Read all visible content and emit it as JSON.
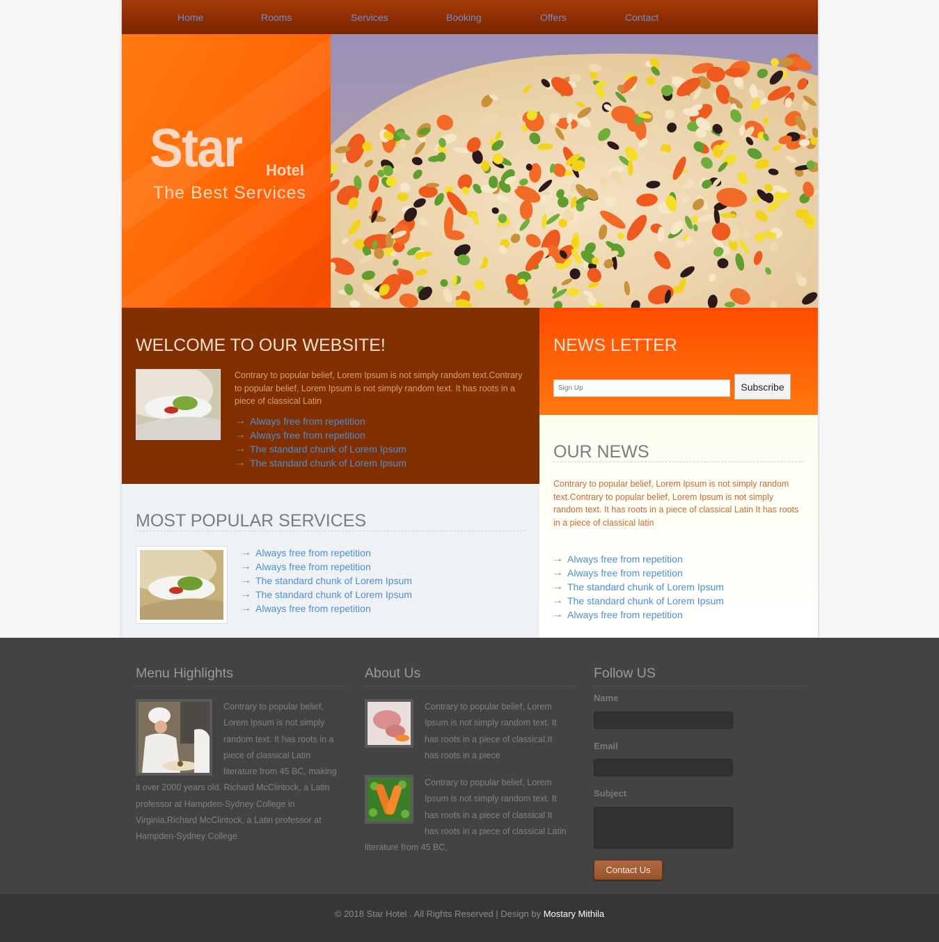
{
  "nav": {
    "items": [
      "Home",
      "Rooms",
      "Services",
      "Booking",
      "Offers",
      "Contact"
    ]
  },
  "hero": {
    "logo_main": "Star",
    "logo_sub": "Hotel",
    "tagline": "The Best Services"
  },
  "welcome": {
    "title": "WELCOME TO OUR WEBSITE!",
    "text": "Contrary to popular belief, Lorem Ipsum is not simply random text.Contrary to popular belief, Lorem Ipsum is not simply random text. It has roots in a piece of classical Latin",
    "items": [
      "Always free from repetition",
      "Always free from repetition",
      "The standard chunk of Lorem Ipsum",
      "The standard chunk of Lorem Ipsum"
    ]
  },
  "newsletter": {
    "title": "NEWS LETTER",
    "placeholder": "Sign Up",
    "button": "Subscribe"
  },
  "our_news": {
    "title": "OUR NEWS",
    "text": "Contrary to popular belief, Lorem Ipsum is not simply random text.Contrary to popular belief, Lorem Ipsum is not simply random text. It has roots in a piece of classical Latin It has roots in a piece of classical latin",
    "items": [
      "Always free from repetition",
      "Always free from repetition",
      "The standard chunk of Lorem Ipsum",
      "The standard chunk of Lorem Ipsum",
      "Always free from repetition"
    ]
  },
  "popular": {
    "title": "MOST POPULAR SERVICES",
    "items": [
      "Always free from repetition",
      "Always free from repetition",
      "The standard chunk of Lorem Ipsum",
      "The standard chunk of Lorem Ipsum",
      "Always free from repetition"
    ]
  },
  "footer": {
    "menu": {
      "title": "Menu Highlights",
      "text": "Contrary to popular belief, Lorem Ipsum is not simply random text. It has roots in a piece of classical Latin literature from 45 BC, making it over 2000 years old. Richard McClintock, a Latin professor at Hampden-Sydney College in Virginia,Richard McClintock, a Latin professor at Hampden-Sydney College"
    },
    "about": {
      "title": "About Us",
      "text1": "Contrary to popular belief, Lorem Ipsum is not simply random text. It has roots in a piece of classical.It has roots in a piece",
      "text2": "Contrary to popular belief, Lorem Ipsum is not simply random text. It has roots in a piece of classical It has roots in a piece of classical Latin literature from 45 BC,"
    },
    "follow": {
      "title": "Follow US",
      "name_label": "Name",
      "email_label": "Email",
      "subject_label": "Subject",
      "button": "Contact Us"
    }
  },
  "copyright": {
    "text": "© 2018 Star Hotel . All Rights Reserved | Design by ",
    "author": "Mostary Mithila"
  },
  "colors": {
    "nav": "#8a2c02",
    "orange": "#ff6a06",
    "welcome_bg": "#822f01",
    "link": "#4f8ed0",
    "footer": "#434343"
  }
}
